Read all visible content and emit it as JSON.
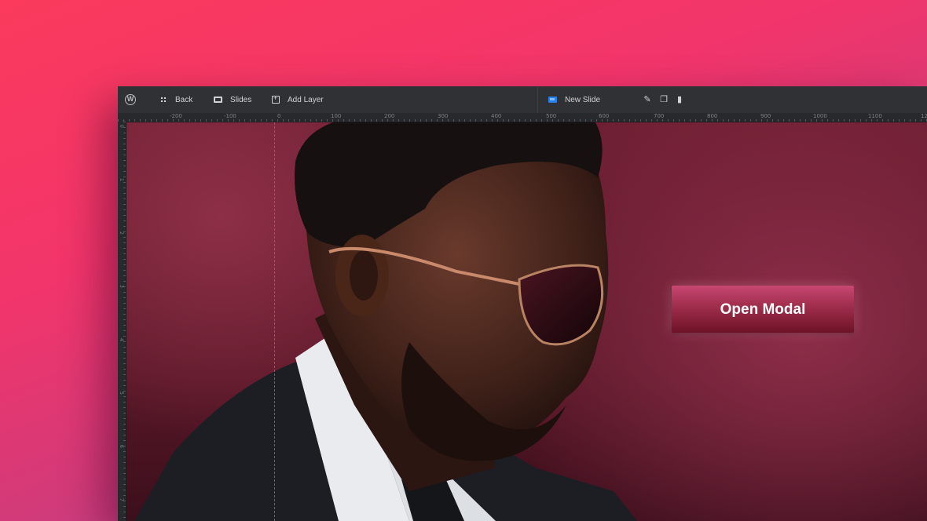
{
  "toolbar": {
    "wp_logo": "W",
    "back_label": "Back",
    "slides_label": "Slides",
    "add_layer_label": "Add Layer",
    "new_slide_label": "New Slide",
    "icons": [
      "wordpress-icon",
      "grid-icon",
      "slides-icon",
      "add-layer-icon",
      "new-slide-icon",
      "pencil-icon",
      "copy-icon",
      "trash-icon"
    ]
  },
  "ruler": {
    "top_ticks": [
      "-200",
      "-100",
      "0",
      "100",
      "200",
      "300",
      "400",
      "500",
      "600",
      "700",
      "800",
      "900",
      "1000",
      "1100",
      "12"
    ],
    "left_ticks": [
      "0",
      "1",
      "2",
      "3",
      "4",
      "5",
      "6",
      "7"
    ]
  },
  "canvas": {
    "image": "man in aviator sunglasses and suit",
    "button_label": "Open Modal"
  },
  "colors": {
    "background_start": "#fb3a5c",
    "background_end": "#a44aa6",
    "toolbar": "#2f3134",
    "accent_blue": "#2b7fe0",
    "button": "#a3304f"
  }
}
